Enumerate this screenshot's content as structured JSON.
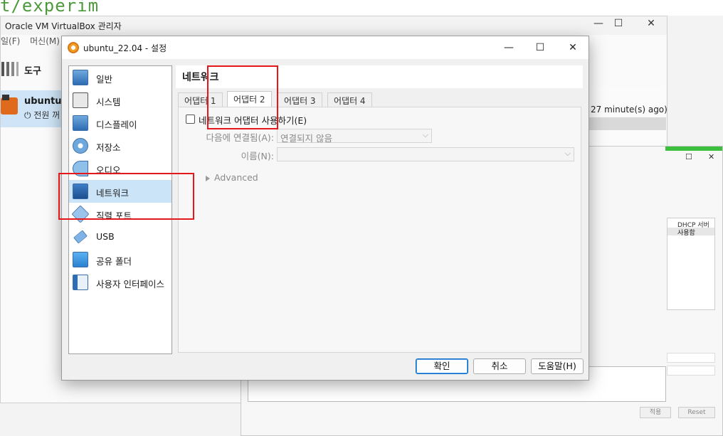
{
  "background": {
    "terminal_text": "t/experim",
    "manager": {
      "title": "Oracle VM VirtualBox 관리자",
      "menu": [
        "일(F)",
        "머신(M)"
      ],
      "tools_label": "도구",
      "vm_name": "ubuntu_",
      "vm_state": "전원 꺼",
      "snapshot_text": "27 minute(s) ago)"
    },
    "net_dialog": {
      "table_header": "DHCP 서버",
      "table_cell": "사용함",
      "apply_button": "적용",
      "reset_button": "Reset"
    }
  },
  "dialog": {
    "title": "ubuntu_22.04 - 설정",
    "sidebar": [
      {
        "label": "일반",
        "icon": "general-icon"
      },
      {
        "label": "시스템",
        "icon": "system-icon"
      },
      {
        "label": "디스플레이",
        "icon": "display-icon"
      },
      {
        "label": "저장소",
        "icon": "storage-icon"
      },
      {
        "label": "오디오",
        "icon": "audio-icon"
      },
      {
        "label": "네트워크",
        "icon": "network-icon",
        "selected": true
      },
      {
        "label": "직렬 포트",
        "icon": "serial-port-icon"
      },
      {
        "label": "USB",
        "icon": "usb-icon"
      },
      {
        "label": "공유 폴더",
        "icon": "shared-folder-icon"
      },
      {
        "label": "사용자 인터페이스",
        "icon": "user-interface-icon"
      }
    ],
    "page_title": "네트워크",
    "tabs": [
      "어댑터 1",
      "어댑터 2",
      "어댑터 3",
      "어댑터 4"
    ],
    "active_tab": "어댑터 2",
    "enable_adapter_label": "네트워크 어댑터 사용하기(E)",
    "enable_adapter_checked": false,
    "attached_to_label": "다음에 연결됨(A):",
    "attached_to_value": "연결되지 않음",
    "name_label": "이름(N):",
    "name_value": "",
    "advanced_label": "Advanced",
    "buttons": {
      "ok": "확인",
      "cancel": "취소",
      "help": "도움말(H)"
    }
  },
  "colors": {
    "accent": "#0067c0",
    "selection": "#cce4f7",
    "annotation": "#e5171b",
    "terminal_green": "#4c9a3c"
  }
}
